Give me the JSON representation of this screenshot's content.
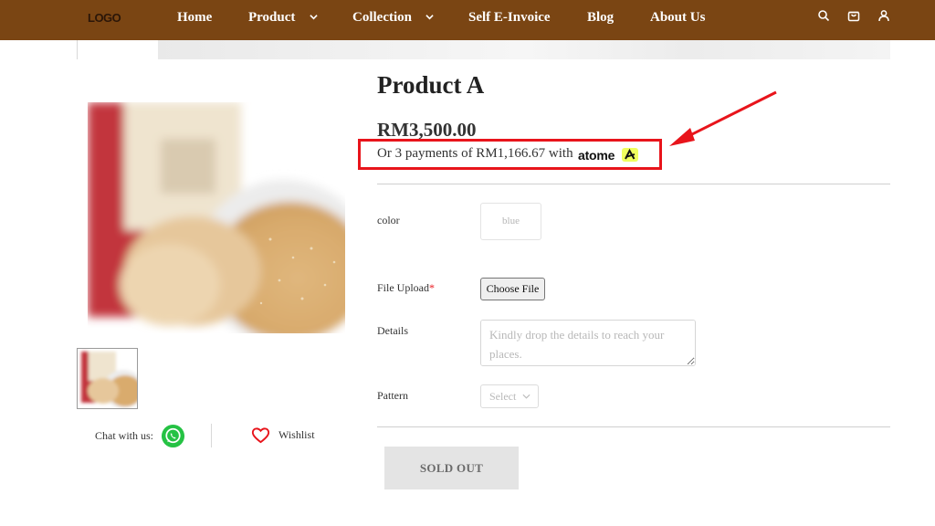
{
  "header": {
    "logo": "LOGO",
    "nav": {
      "home": "Home",
      "product": "Product",
      "collection": "Collection",
      "self_e_invoice": "Self E-Invoice",
      "blog": "Blog",
      "about": "About Us"
    },
    "icons": [
      "search-icon",
      "cart-icon",
      "user-icon"
    ],
    "background_color": "#7a4513"
  },
  "gallery": {
    "chat_label": "Chat with us:",
    "wishlist_label": "Wishlist"
  },
  "product": {
    "title": "Product A",
    "price": "RM3,500.00",
    "installment_text": "Or 3 payments of RM1,166.67 with",
    "installment_provider": "atome",
    "highlight_color": "#e8141b"
  },
  "options": {
    "color_label": "color",
    "color_value": "blue",
    "file_label": "File Upload",
    "file_required_mark": "*",
    "file_button": "Choose File",
    "details_label": "Details",
    "details_placeholder": "Kindly drop the details to reach your places.",
    "pattern_label": "Pattern",
    "pattern_value": "Select"
  },
  "actions": {
    "sold_out": "SOLD OUT"
  }
}
